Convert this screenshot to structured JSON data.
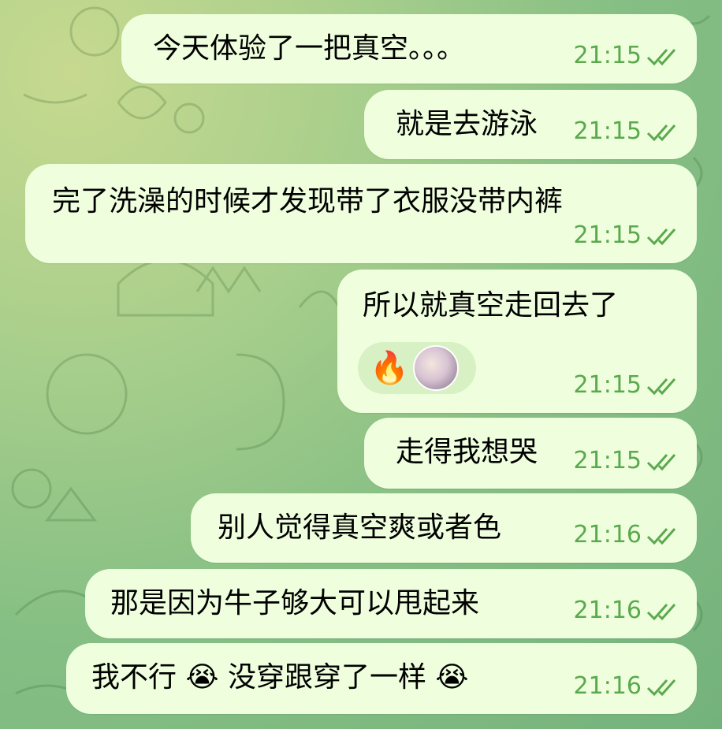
{
  "messages": [
    {
      "text": "今天体验了一把真空。。。",
      "time": "21:15"
    },
    {
      "text": "就是去游泳",
      "time": "21:15"
    },
    {
      "text": "完了洗澡的时候才发现带了衣服没带内裤",
      "time": "21:15"
    },
    {
      "text": "所以就真空走回去了",
      "time": "21:15",
      "reaction": "🔥"
    },
    {
      "text": "走得我想哭",
      "time": "21:15"
    },
    {
      "text": "别人觉得真空爽或者色",
      "time": "21:16"
    },
    {
      "text": "那是因为牛子够大可以甩起来",
      "time": "21:16"
    },
    {
      "text": "我不行 😭 没穿跟穿了一样 😭",
      "time": "21:16"
    }
  ],
  "colors": {
    "bubble": "#efffde",
    "time": "#5aa94c",
    "background": "#86bf84"
  },
  "icons": {
    "read_status": "double-check-icon",
    "reaction_avatar": "avatar"
  }
}
